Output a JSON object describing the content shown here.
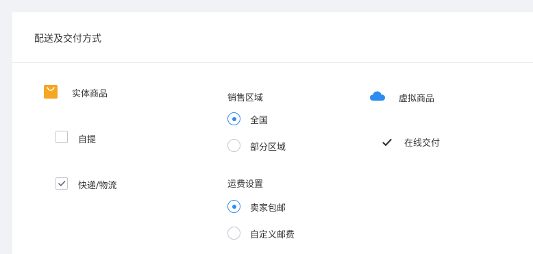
{
  "card": {
    "title": "配送及交付方式"
  },
  "physical": {
    "label": "实体商品",
    "icon": "shopping-bag-icon",
    "icon_color": "#f5a623",
    "options": [
      {
        "label": "自提",
        "checked": false
      },
      {
        "label": "快递/物流",
        "checked": true
      }
    ]
  },
  "sales_area": {
    "label": "销售区域",
    "options": [
      {
        "label": "全国",
        "selected": true
      },
      {
        "label": "部分区域",
        "selected": false
      }
    ]
  },
  "shipping": {
    "label": "运费设置",
    "options": [
      {
        "label": "卖家包邮",
        "selected": true
      },
      {
        "label": "自定义邮费",
        "selected": false
      }
    ]
  },
  "virtual": {
    "label": "虚拟商品",
    "icon": "cloud-icon",
    "icon_color": "#2d8cf0",
    "delivery": {
      "label": "在线交付",
      "icon": "checkmark-icon"
    }
  },
  "colors": {
    "accent": "#2d8cf0",
    "bag": "#f5a623",
    "border": "#c3c6cc"
  }
}
